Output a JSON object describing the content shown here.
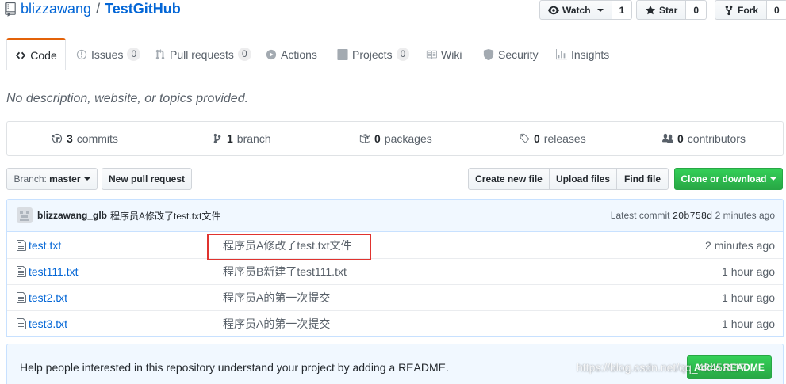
{
  "repo": {
    "owner": "blizzawang",
    "separator": "/",
    "name": "TestGitHub"
  },
  "social": {
    "watch": {
      "label": "Watch",
      "count": "1"
    },
    "star": {
      "label": "Star",
      "count": "0"
    },
    "fork": {
      "label": "Fork",
      "count": "0"
    }
  },
  "tabs": [
    {
      "label": "Code",
      "icon": "code-icon",
      "selected": true
    },
    {
      "label": "Issues",
      "icon": "issue-icon",
      "counter": "0"
    },
    {
      "label": "Pull requests",
      "icon": "pull-request-icon",
      "counter": "0"
    },
    {
      "label": "Actions",
      "icon": "play-icon"
    },
    {
      "label": "Projects",
      "icon": "project-icon",
      "counter": "0"
    },
    {
      "label": "Wiki",
      "icon": "book-icon"
    },
    {
      "label": "Security",
      "icon": "shield-icon"
    },
    {
      "label": "Insights",
      "icon": "graph-icon"
    }
  ],
  "description": "No description, website, or topics provided.",
  "summary": {
    "commits": {
      "count": "3",
      "label": "commits"
    },
    "branches": {
      "count": "1",
      "label": "branch"
    },
    "packages": {
      "count": "0",
      "label": "packages"
    },
    "releases": {
      "count": "0",
      "label": "releases"
    },
    "contributors": {
      "count": "0",
      "label": "contributors"
    }
  },
  "toolbar": {
    "branch_prefix": "Branch:",
    "branch_name": "master",
    "new_pr": "New pull request",
    "create_file": "Create new file",
    "upload_files": "Upload files",
    "find_file": "Find file",
    "clone": "Clone or download"
  },
  "latest_commit": {
    "author": "blizzawang_glb",
    "message": "程序员A修改了test.txt文件",
    "prefix": "Latest commit",
    "sha": "20b758d",
    "age": "2 minutes ago"
  },
  "files": [
    {
      "name": "test.txt",
      "message": "程序员A修改了test.txt文件",
      "age": "2 minutes ago"
    },
    {
      "name": "test111.txt",
      "message": "程序员B新建了test111.txt",
      "age": "1 hour ago"
    },
    {
      "name": "test2.txt",
      "message": "程序员A的第一次提交",
      "age": "1 hour ago"
    },
    {
      "name": "test3.txt",
      "message": "程序员A的第一次提交",
      "age": "1 hour ago"
    }
  ],
  "readme": {
    "text": "Help people interested in this repository understand your project by adding a README.",
    "button": "Add a README"
  },
  "watermark": "https://blog.csdn.net/qq_42453117",
  "colors": {
    "link": "#0366d6",
    "green": "#28a745",
    "tab_accent": "#e36209",
    "highlight": "#e0332f"
  }
}
